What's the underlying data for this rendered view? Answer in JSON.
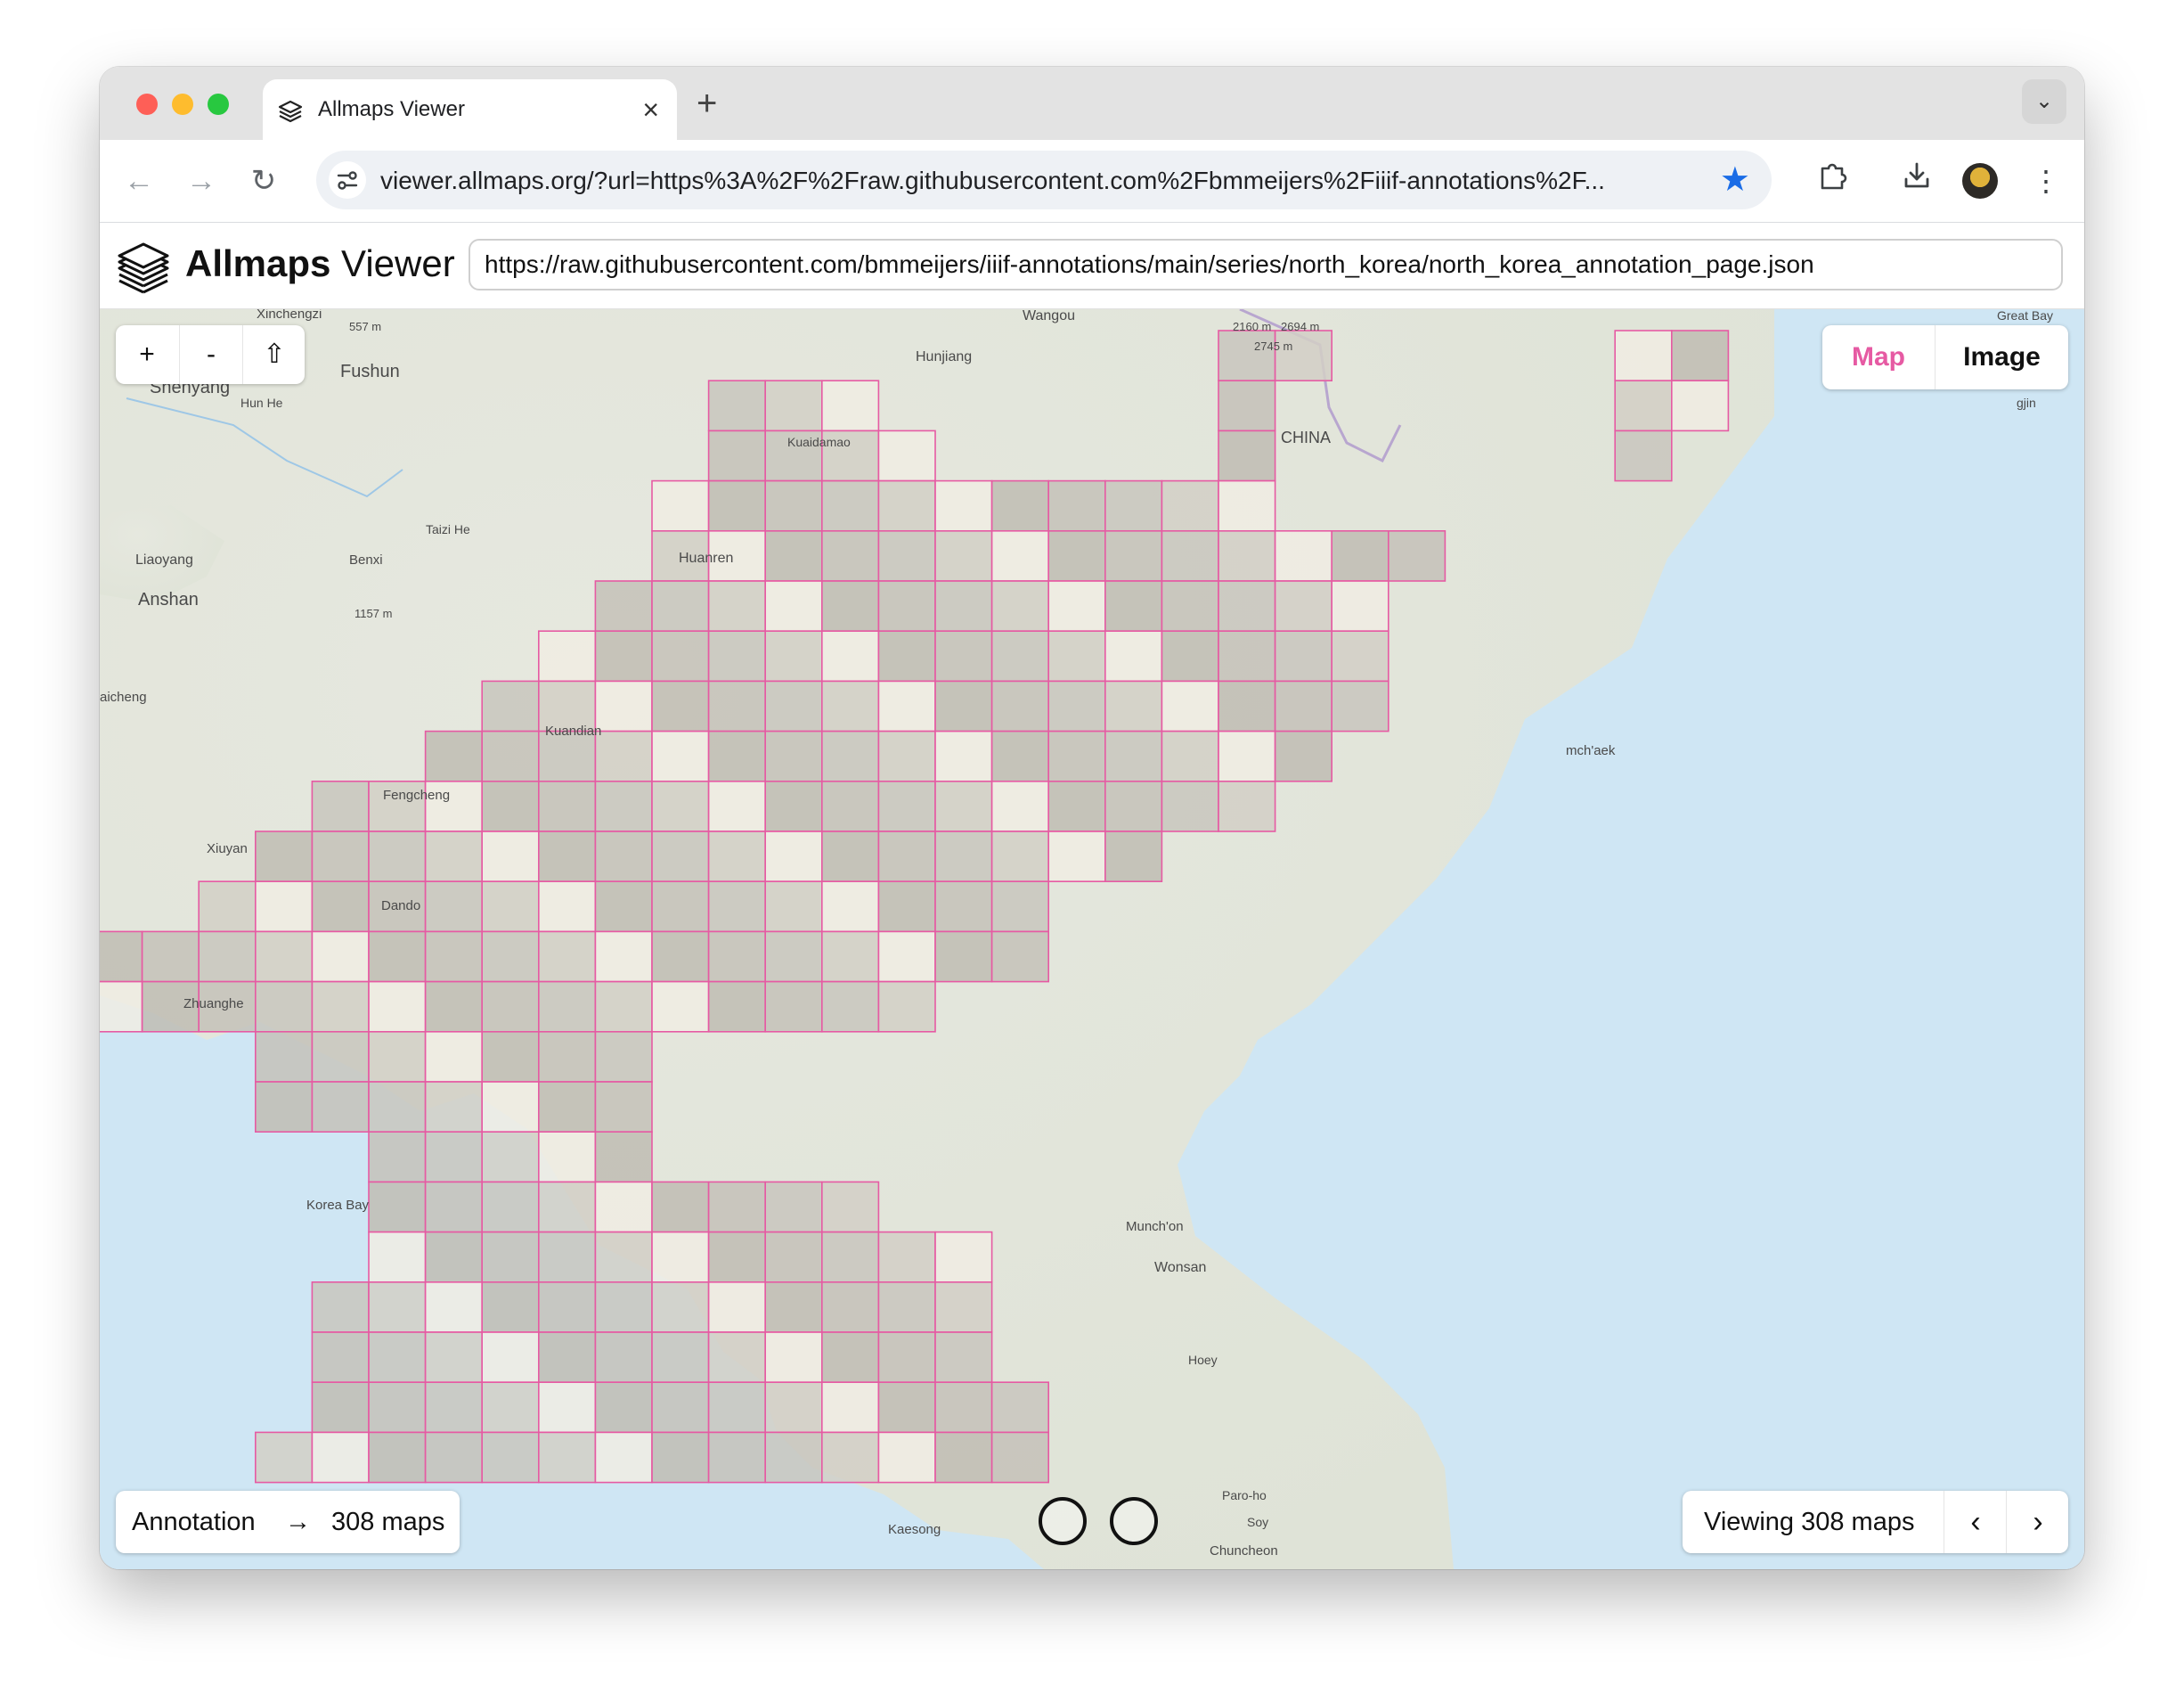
{
  "browser": {
    "tab_title": "Allmaps Viewer",
    "tab_close": "×",
    "new_tab": "+",
    "tab_menu": "⌄",
    "back": "←",
    "forward": "→",
    "reload": "↻",
    "url": "viewer.allmaps.org/?url=https%3A%2F%2Fraw.githubusercontent.com%2Fbmmeijers%2Fiiif-annotations%2F...",
    "star": "★",
    "extensions_icon": "extensions-icon",
    "download_icon": "download-icon",
    "menu_icon": "⋮"
  },
  "app": {
    "brand_bold": "Allmaps",
    "brand_light": " Viewer",
    "annotation_url": "https://raw.githubusercontent.com/bmmeijers/iiif-annotations/main/series/north_korea/north_korea_annotation_page.json"
  },
  "map": {
    "zoom_in": "+",
    "zoom_out": "-",
    "home": "⇧",
    "toggle_map": "Map",
    "toggle_image": "Image",
    "annotation_label": "Annotation",
    "annotation_arrow": "→",
    "annotation_count": "308 maps",
    "viewing_text": "Viewing 308 maps",
    "prev": "‹",
    "next": "›",
    "accent_color": "#e65aa3",
    "place_labels": [
      {
        "text": "Xinchengzi"
      },
      {
        "text": "557 m"
      },
      {
        "text": "Wangou"
      },
      {
        "text": "2160 m"
      },
      {
        "text": "2694 m"
      },
      {
        "text": "2745 m"
      },
      {
        "text": "Great Bay"
      },
      {
        "text": "Fushun"
      },
      {
        "text": "Shenyang"
      },
      {
        "text": "Hun He"
      },
      {
        "text": "Hunjiang"
      },
      {
        "text": "CHINA"
      },
      {
        "text": "gjin"
      },
      {
        "text": "Kuaidamao"
      },
      {
        "text": "Taizi He"
      },
      {
        "text": "Liaoyang"
      },
      {
        "text": "Benxi"
      },
      {
        "text": "Huanren"
      },
      {
        "text": "Anshan"
      },
      {
        "text": "1157 m"
      },
      {
        "text": "aicheng"
      },
      {
        "text": "Kuandian"
      },
      {
        "text": "mch'aek"
      },
      {
        "text": "Fengcheng"
      },
      {
        "text": "Xiuyan"
      },
      {
        "text": "Dando"
      },
      {
        "text": "Zhuanghe"
      },
      {
        "text": "Korea Bay"
      },
      {
        "text": "Munch'on"
      },
      {
        "text": "Wonsan"
      },
      {
        "text": "Hoey"
      },
      {
        "text": "Kaesong"
      },
      {
        "text": "Chuncheon"
      },
      {
        "text": "Soy"
      },
      {
        "text": "Paro-ho"
      }
    ]
  }
}
